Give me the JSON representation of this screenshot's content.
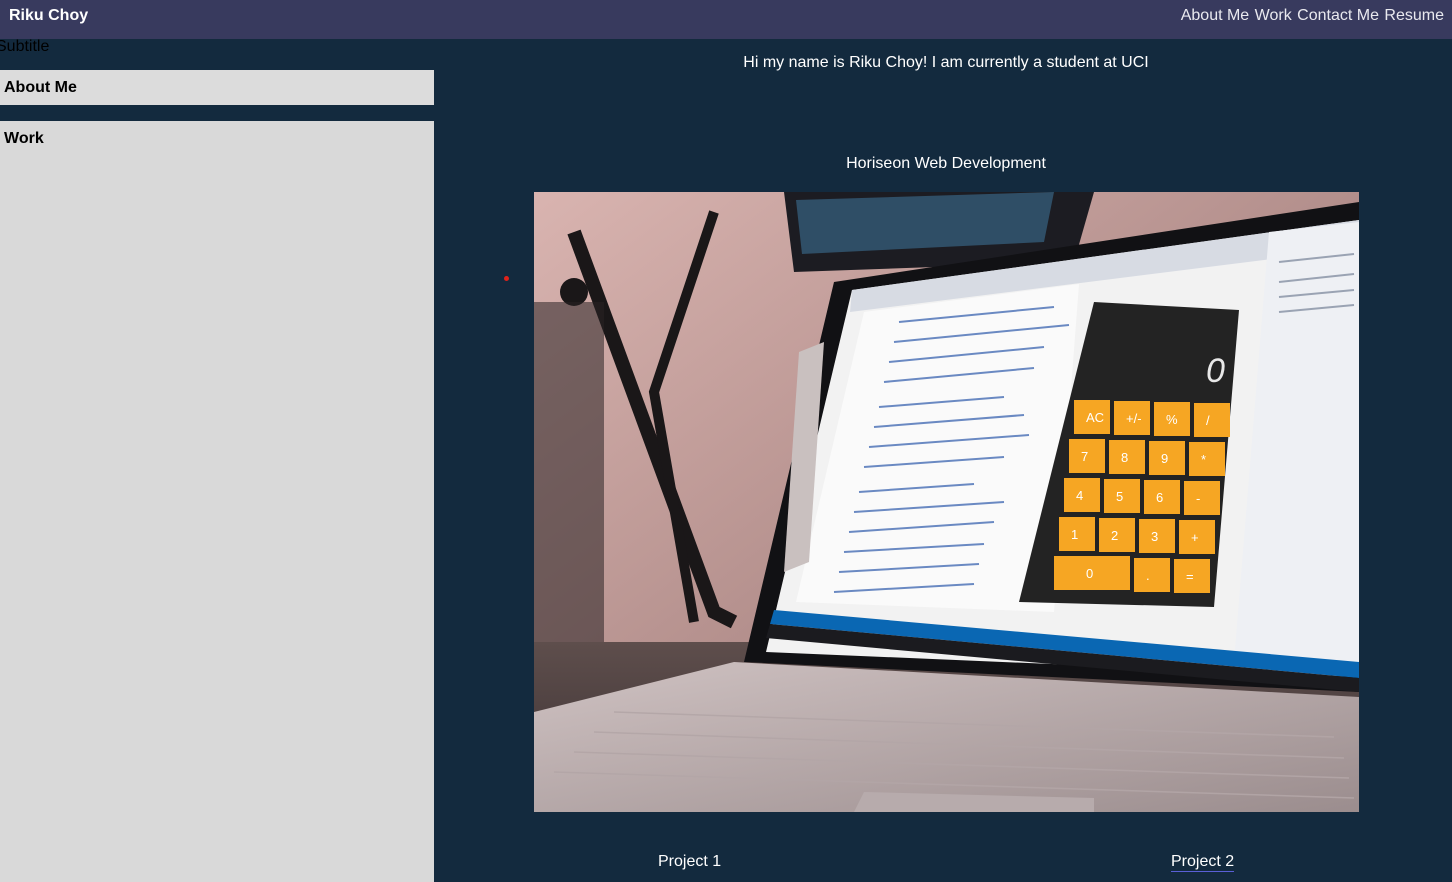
{
  "header": {
    "brand": "Riku Choy",
    "nav": [
      "About Me",
      "Work",
      "Contact Me",
      "Resume"
    ]
  },
  "sidebar": {
    "subtitle": "Subtitle",
    "sections": [
      "About Me",
      "Work"
    ]
  },
  "main": {
    "intro": "Hi my name is Riku Choy! I am currently a student at UCI",
    "project_title": "Horiseon Web Development",
    "projects": [
      "Project 1",
      "Project 2"
    ],
    "calculator_keys": [
      "AC",
      "+/-",
      "%",
      "/",
      "7",
      "8",
      "9",
      "*",
      "4",
      "5",
      "6",
      "-",
      "1",
      "2",
      "3",
      "+",
      "0",
      ".",
      "="
    ],
    "calculator_display": "0"
  },
  "colors": {
    "header_bg": "#383a5e",
    "page_bg": "#132a3e",
    "sidebar_card": "#d9d9d9",
    "calc_key": "#f6a623"
  }
}
